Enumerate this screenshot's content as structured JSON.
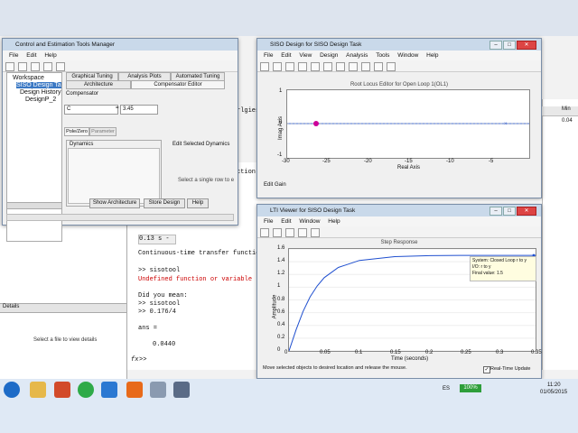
{
  "cmd": {
    "line1": "Continuous-time transfer function.",
    "line2": ">> sisotool",
    "line3": "Undefined function or variable 'si",
    "line4": "Did you mean:",
    "line5": ">> sisotool",
    "line6": ">> 0.176/4",
    "line7": "ans =",
    "line8": "0.0440",
    "prompt": ">>",
    "fx": "fx",
    "frag1": "ction.",
    "frag2": "rlgies_ort",
    "boxval": "0.13 s -"
  },
  "right": {
    "header": "Min",
    "val": "0.04"
  },
  "details": {
    "header": "Details",
    "text": "Select a file to view details"
  },
  "cetm": {
    "title": "Control and Estimation Tools Manager",
    "menu": [
      "File",
      "Edit",
      "Help"
    ],
    "tree": [
      "Workspace",
      "SISO Design Ta",
      "Design History",
      "DesignP_2"
    ],
    "tabs_top": [
      "Graphical Tuning",
      "Analysis Plots",
      "Automated Tuning"
    ],
    "tabs_mid": [
      "Architecture",
      "Compensator Editor"
    ],
    "compensator_label": "Compensator",
    "comp_select": "C",
    "comp_eq": "=",
    "comp_value": "3.45",
    "subtabs": [
      "Pole/Zero",
      "Parameter"
    ],
    "dynamics": "Dynamics",
    "edit_dyn": "Edit Selected Dynamics",
    "select_row": "Select a single row to e",
    "buttons": [
      "Show Architecture",
      "Store Design",
      "Help"
    ]
  },
  "siso": {
    "title": "SISO Design for SISO Design Task",
    "menu": [
      "File",
      "Edit",
      "View",
      "Design",
      "Analysis",
      "Tools",
      "Window",
      "Help"
    ],
    "plot_title": "Root Locus Editor for Open Loop 1(OL1)",
    "ylabel": "Imag Axis",
    "xlabel": "Real Axis",
    "yticks": [
      "1",
      "0",
      "-1"
    ],
    "xticks": [
      "-30",
      "-25",
      "-20",
      "-15",
      "-10",
      "-5"
    ],
    "status": "Edit Gain",
    "pole_color": "#cc0099"
  },
  "lti": {
    "title": "LTI Viewer for SISO Design Task",
    "menu": [
      "File",
      "Edit",
      "Window",
      "Help"
    ],
    "plot_title": "Step Response",
    "ylabel": "Amplitude",
    "xlabel": "Time (seconds)",
    "yticks": [
      "1.6",
      "1.4",
      "1.2",
      "1",
      "0.8",
      "0.6",
      "0.4",
      "0.2",
      "0"
    ],
    "xticks": [
      "0",
      "0.05",
      "0.1",
      "0.15",
      "0.2",
      "0.25",
      "0.3",
      "0.35"
    ],
    "tooltip": [
      "System: Closed Loop r to y",
      "I/O: r to y",
      "Final value: 1.5"
    ],
    "status": "Move selected objects to desired location and release the mouse.",
    "realtime": "Real-Time Update",
    "line_color": "#1f4fcf"
  },
  "chart_data": {
    "type": "line",
    "title": "Step Response",
    "xlabel": "Time (seconds)",
    "ylabel": "Amplitude",
    "xlim": [
      0,
      0.35
    ],
    "ylim": [
      0,
      1.6
    ],
    "series": [
      {
        "name": "Closed Loop r to y",
        "x": [
          0,
          0.01,
          0.02,
          0.03,
          0.04,
          0.05,
          0.07,
          0.1,
          0.15,
          0.2,
          0.25,
          0.3,
          0.35
        ],
        "y": [
          0,
          0.33,
          0.62,
          0.85,
          1.02,
          1.15,
          1.31,
          1.42,
          1.48,
          1.495,
          1.5,
          1.5,
          1.5
        ]
      }
    ]
  },
  "taskbar": {
    "lang": "ES",
    "battery": "100%",
    "time": "11:20",
    "date": "01/05/2015"
  }
}
